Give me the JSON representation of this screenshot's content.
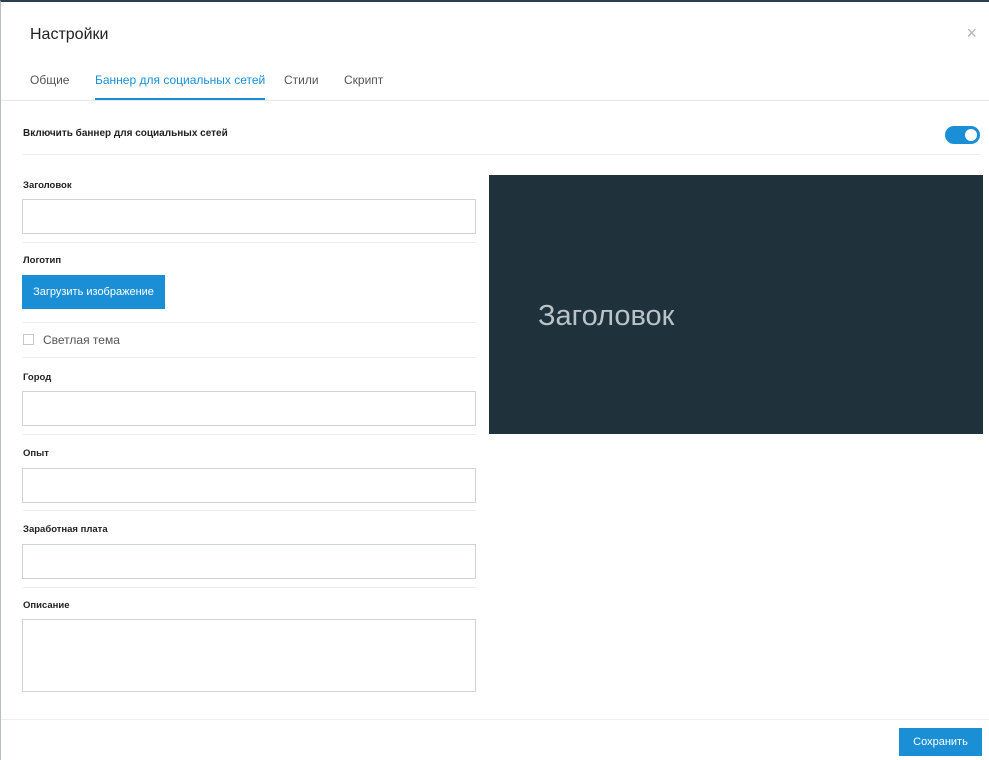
{
  "dialog": {
    "title": "Настройки",
    "close_icon": "close-icon",
    "close_glyph": "×"
  },
  "tabs": [
    {
      "label": "Общие",
      "active": false
    },
    {
      "label": "Баннер для социальных сетей",
      "active": true
    },
    {
      "label": "Стили",
      "active": false
    },
    {
      "label": "Скрипт",
      "active": false
    }
  ],
  "banner_toggle": {
    "label": "Включить баннер для социальных сетей",
    "enabled": true
  },
  "form": {
    "heading_label": "Заголовок",
    "heading_value": "",
    "logo_label": "Логотип",
    "upload_button": "Загрузить изображение",
    "light_theme_label": "Светлая тема",
    "light_theme_checked": false,
    "city_label": "Город",
    "city_value": "",
    "experience_label": "Опыт",
    "experience_value": "",
    "salary_label": "Заработная плата",
    "salary_value": "",
    "description_label": "Описание",
    "description_value": ""
  },
  "preview": {
    "title": "Заголовок",
    "background_color": "#1f313b"
  },
  "footer": {
    "save_button": "Сохранить"
  },
  "colors": {
    "accent": "#1a8fd6"
  }
}
